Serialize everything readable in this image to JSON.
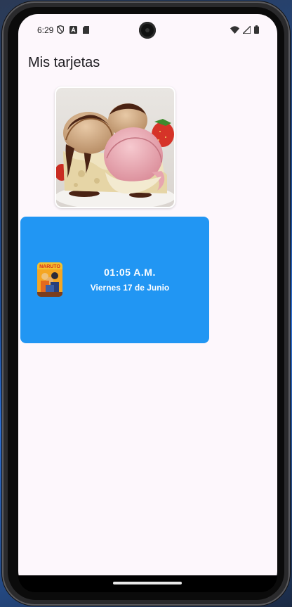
{
  "status_bar": {
    "time": "6:29",
    "left_icons": [
      "vpn-shield-icon",
      "translate-icon",
      "sd-card-icon"
    ],
    "right_icons": [
      "wifi-icon",
      "signal-icon",
      "battery-icon"
    ]
  },
  "app": {
    "title": "Mis tarjetas"
  },
  "image_card": {
    "image": "ice-cream-dessert-image"
  },
  "clock_card": {
    "time": "01:05 A.M.",
    "date": "Viernes 17 de Junio",
    "thumbnail": "anime-poster-thumbnail",
    "thumbnail_label": "NARUTO",
    "background": "#2196f3",
    "text_color": "#ffffff"
  },
  "colors": {
    "screen_bg": "#fdf7fc",
    "accent": "#2196f3"
  }
}
